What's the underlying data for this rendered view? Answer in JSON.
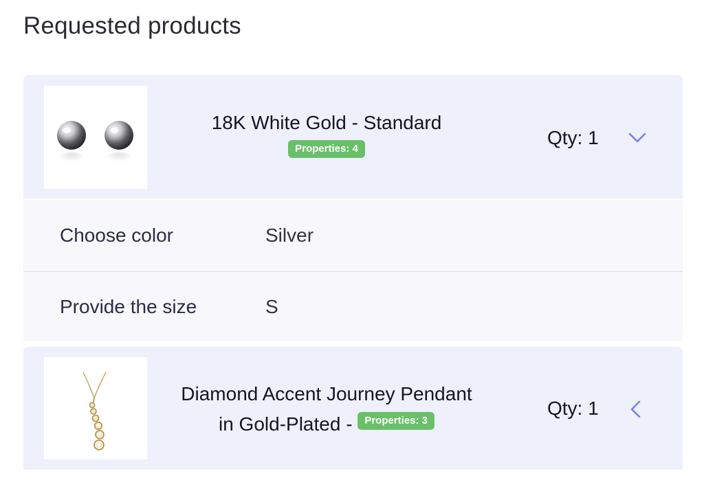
{
  "page": {
    "title": "Requested products"
  },
  "products": [
    {
      "name": "18K White Gold - Standard",
      "badge": "Properties: 4",
      "qty": "Qty: 1",
      "expanded": true,
      "image": "silver-ball-stud-earrings",
      "properties": [
        {
          "label": "Choose color",
          "value": "Silver"
        },
        {
          "label": "Provide the size",
          "value": "S"
        }
      ]
    },
    {
      "name_line1": "Diamond Accent Journey Pendant",
      "name_line2": "in Gold-Plated -",
      "badge": "Properties: 3",
      "qty": "Qty: 1",
      "expanded": false,
      "image": "gold-journey-pendant-necklace"
    }
  ],
  "colors": {
    "card_bg": "#eef0fb",
    "badge": "#6abf69",
    "chevron": "#7b7fe8"
  }
}
